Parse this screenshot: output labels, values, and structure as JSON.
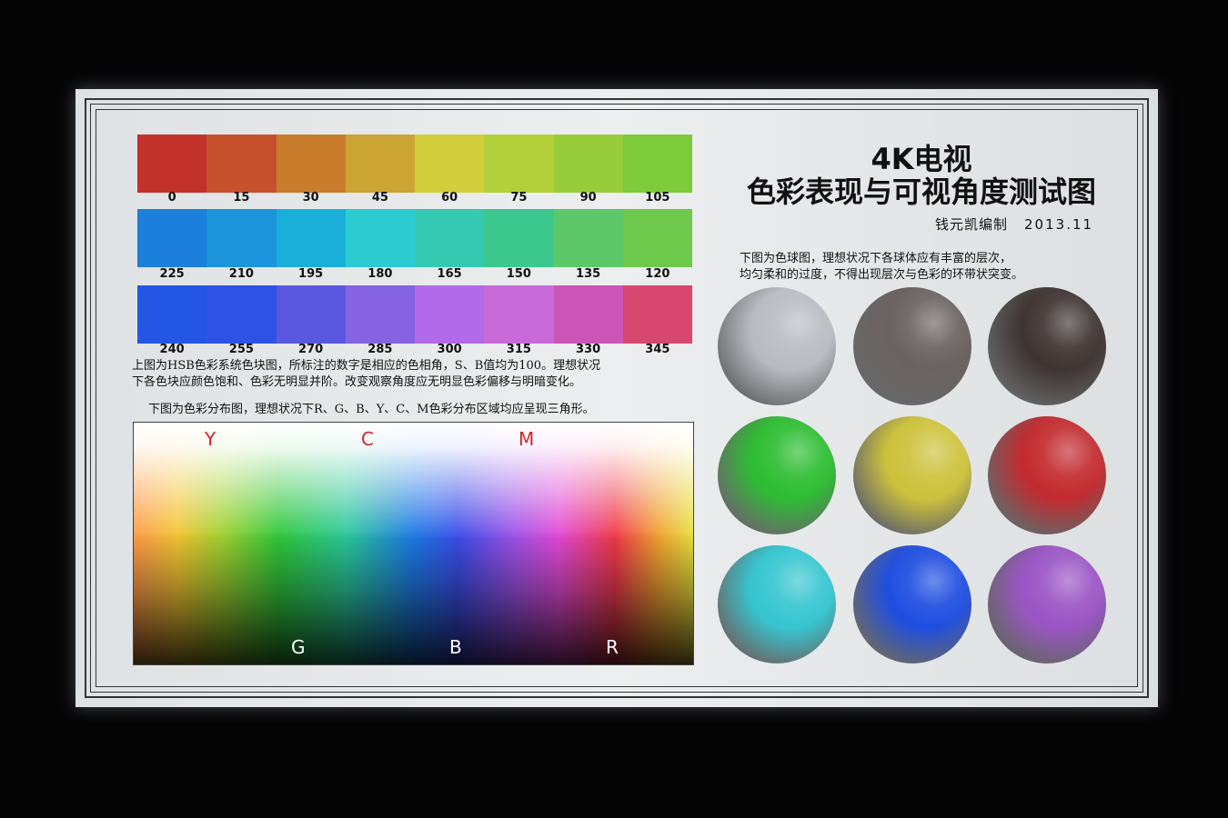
{
  "colors": {
    "row1": [
      "#c3322a",
      "#c7512d",
      "#c97d2c",
      "#cba434",
      "#d2cd3a",
      "#b3cf3a",
      "#97cd3a",
      "#7dca3a"
    ],
    "row2": [
      "#1c7fdc",
      "#1c94dc",
      "#19afd9",
      "#2ccbd2",
      "#35c9b2",
      "#3cc78f",
      "#5cc869",
      "#6ec84c"
    ],
    "row3": [
      "#2456e6",
      "#2f52e6",
      "#5a58e0",
      "#8563e2",
      "#b26ae8",
      "#c76ad8",
      "#cb55b6",
      "#d7476f"
    ],
    "balls": [
      "#b8bcc2",
      "#6a6260",
      "#3e3432",
      "#2dbd32",
      "#cdc23c",
      "#c22b2f",
      "#36c6d0",
      "#1f4ee0",
      "#9a55c4"
    ]
  },
  "hue_labels": {
    "row1": [
      "0",
      "15",
      "30",
      "45",
      "60",
      "75",
      "90",
      "105"
    ],
    "row2": [
      "225",
      "210",
      "195",
      "180",
      "165",
      "150",
      "135",
      "120"
    ],
    "row3": [
      "240",
      "255",
      "270",
      "285",
      "300",
      "315",
      "330",
      "345"
    ]
  },
  "captions": {
    "hsb_line1": "上图为HSB色彩系统色块图，所标注的数字是相应的色相角，S、B值均为100。理想状况",
    "hsb_line2": "下各色块应颜色饱和、色彩无明显并阶。改变观察角度应无明显色彩偏移与明暗变化。",
    "dist_caption": "下图为色彩分布图，理想状况下R、G、B、Y、C、M色彩分布区域均应呈现三角形。",
    "ball_line1": "下图为色球图，理想状况下各球体应有丰富的层次，",
    "ball_line2": "均匀柔和的过度，不得出现层次与色彩的环带状突变。"
  },
  "distribution_labels": {
    "top": [
      "Y",
      "C",
      "M"
    ],
    "bottom": [
      "G",
      "B",
      "R"
    ]
  },
  "title": {
    "line1": "4K电视",
    "line2": "色彩表现与可视角度测试图"
  },
  "author": {
    "name": "钱元凯编制",
    "date": "2013.11"
  }
}
